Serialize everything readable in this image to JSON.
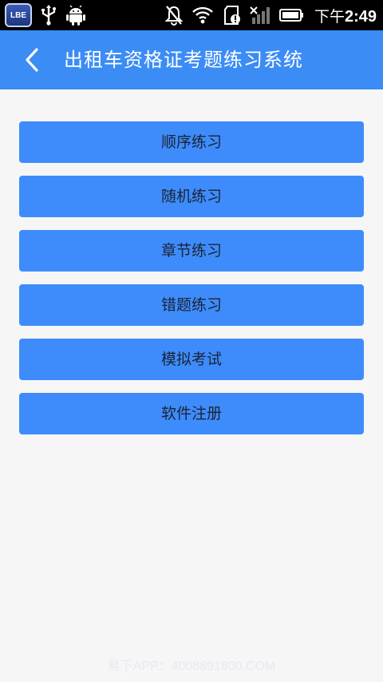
{
  "status_bar": {
    "app_badge": "LBE",
    "time_prefix": "下午",
    "time": "2:49",
    "icons": [
      "usb-icon",
      "android-icon",
      "muted-bell-icon",
      "wifi-icon",
      "sd-card-alert-icon",
      "no-signal-icon",
      "battery-icon"
    ]
  },
  "app_bar": {
    "title": "出租车资格证考题练习系统",
    "back_icon": "chevron-left-icon",
    "background": "#3b8cf5"
  },
  "menu": {
    "items": [
      {
        "label": "顺序练习"
      },
      {
        "label": "随机练习"
      },
      {
        "label": "章节练习"
      },
      {
        "label": "错题练习"
      },
      {
        "label": "模拟考试"
      },
      {
        "label": "软件注册"
      }
    ],
    "button_color": "#3e8cfc"
  },
  "watermark": "易下APP：4008891800.COM"
}
